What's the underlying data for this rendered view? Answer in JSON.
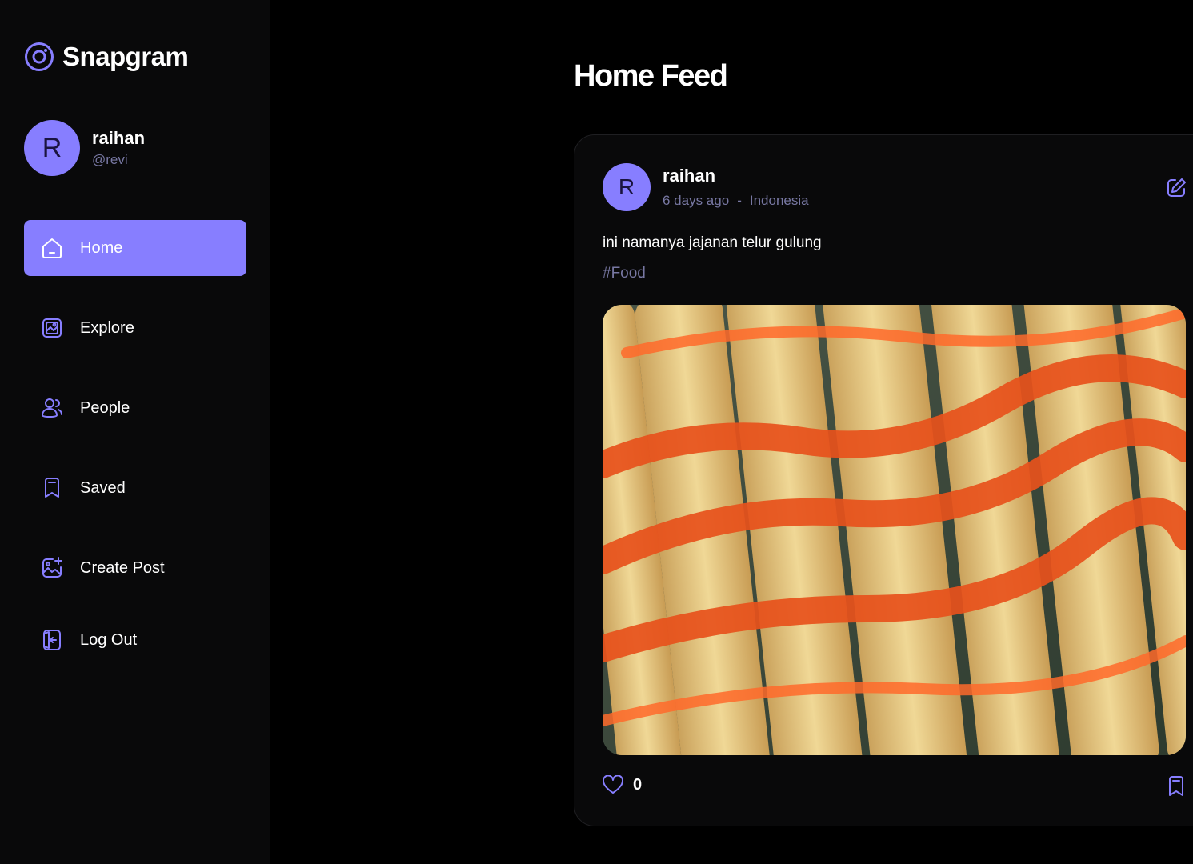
{
  "app": {
    "name": "Snapgram",
    "accent": "#877eff"
  },
  "user": {
    "name": "raihan",
    "handle": "@revi",
    "initial": "R"
  },
  "nav": [
    {
      "label": "Home",
      "icon": "home-icon",
      "active": true
    },
    {
      "label": "Explore",
      "icon": "explore-icon",
      "active": false
    },
    {
      "label": "People",
      "icon": "people-icon",
      "active": false
    },
    {
      "label": "Saved",
      "icon": "bookmark-icon",
      "active": false
    },
    {
      "label": "Create Post",
      "icon": "gallery-add-icon",
      "active": false
    },
    {
      "label": "Log Out",
      "icon": "logout-icon",
      "active": false
    }
  ],
  "main": {
    "title": "Home Feed"
  },
  "post": {
    "author": "raihan",
    "author_initial": "R",
    "time": "6 days ago",
    "separator": "-",
    "location": "Indonesia",
    "caption": "ini namanya jajanan telur gulung",
    "tag": "#Food",
    "likes": "0",
    "image": "fried egg rolls on skewers with chili sauce"
  }
}
